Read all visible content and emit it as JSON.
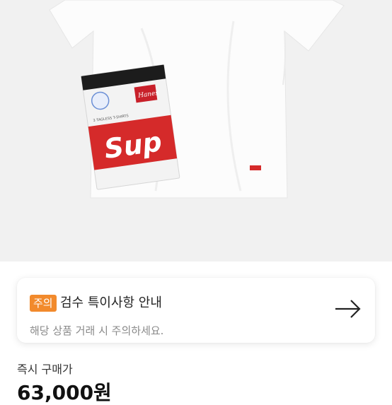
{
  "product_image": {
    "brand_logo": "Sup",
    "package_brand": "Hanes",
    "package_caption": "3 TAGLESS T-SHIRTS"
  },
  "notice": {
    "badge": "주의",
    "title": "검수 특이사항 안내",
    "subtitle": "해당 상품 거래 시 주의하세요.",
    "arrow_icon": "arrow-right-icon"
  },
  "purchase": {
    "label": "즉시 구매가",
    "price": "63,000원"
  },
  "colors": {
    "badge": "#f28a2c",
    "supreme_red": "#d52a2a",
    "hanes_red": "#c8202a"
  }
}
